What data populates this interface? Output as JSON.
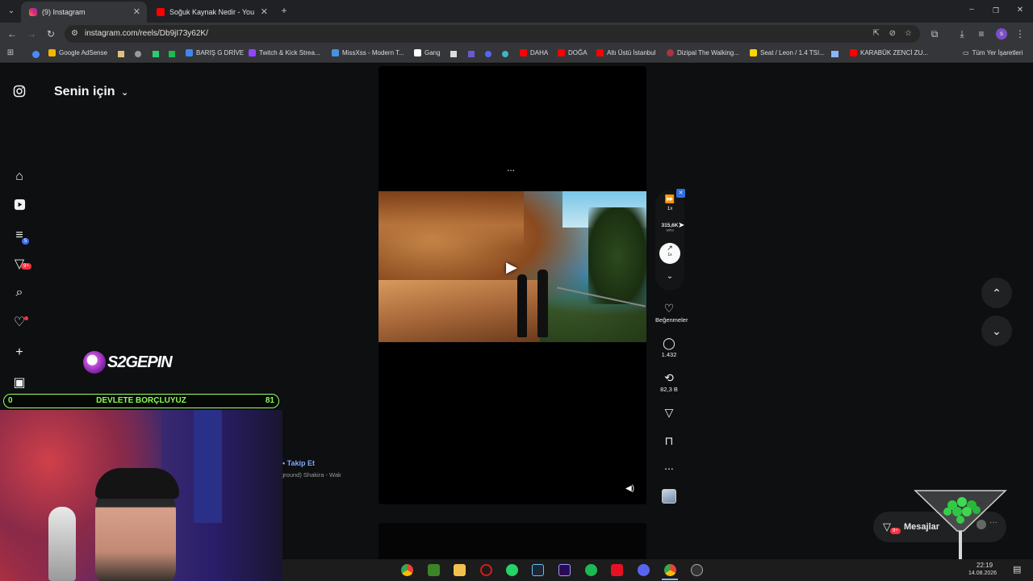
{
  "tabs": [
    {
      "label": "(9) Instagram",
      "icon": "instagram-icon",
      "active": true
    },
    {
      "label": "Soğuk Kaynak Nedir - YouTu",
      "icon": "youtube-icon",
      "active": false
    }
  ],
  "address": {
    "url": "instagram.com/reels/Db9jI73y62K/"
  },
  "bookmarks": [
    {
      "label": "Google AdSense",
      "color": "#f4b400"
    },
    {
      "label": "BARIŞ G DRİVE",
      "color": "#4285f4"
    },
    {
      "label": "Twitch & Kick Strea...",
      "color": "#9146ff"
    },
    {
      "label": "MissXss - Modern T...",
      "color": "#4a90e2"
    },
    {
      "label": "Gang",
      "color": "#ffffff"
    },
    {
      "label": "DAHA",
      "color": "#ff0000"
    },
    {
      "label": "DOĞA",
      "color": "#ff0000"
    },
    {
      "label": "Altı Üstü İstanbul",
      "color": "#ff0000"
    },
    {
      "label": "Dizipal The Walking...",
      "color": "#aa3344"
    },
    {
      "label": "Seat / Leon / 1.4 TSI...",
      "color": "#ffd400"
    },
    {
      "label": "KARABÜK ZENCİ ZU...",
      "color": "#ff0000"
    }
  ],
  "bookmarks_all": "Tüm Yer İşaretleri",
  "feed": {
    "title": "Senin için"
  },
  "nav_badges": {
    "notifications": "9+",
    "explore_badge": "5"
  },
  "video": {
    "more": "...",
    "follow": "• Takip Et",
    "audio": "ground)  Shakira - Wak"
  },
  "speed": {
    "rate": "1x",
    "views": "315,6K",
    "views_unit": "VPH",
    "trend": "1x"
  },
  "actions": {
    "likes": "Beğenmeler",
    "comments": "1.432",
    "reposts": "82,3 B",
    "more": "..."
  },
  "messages": {
    "label": "Mesajlar",
    "badge": "9+"
  },
  "overlay": {
    "logo": "S2GEPIN",
    "status_left": "0",
    "status_text": "DEVLETE BORÇLUYUZ",
    "status_right": "81"
  },
  "clock": {
    "time": "22:19",
    "date": "14.08.2026"
  }
}
